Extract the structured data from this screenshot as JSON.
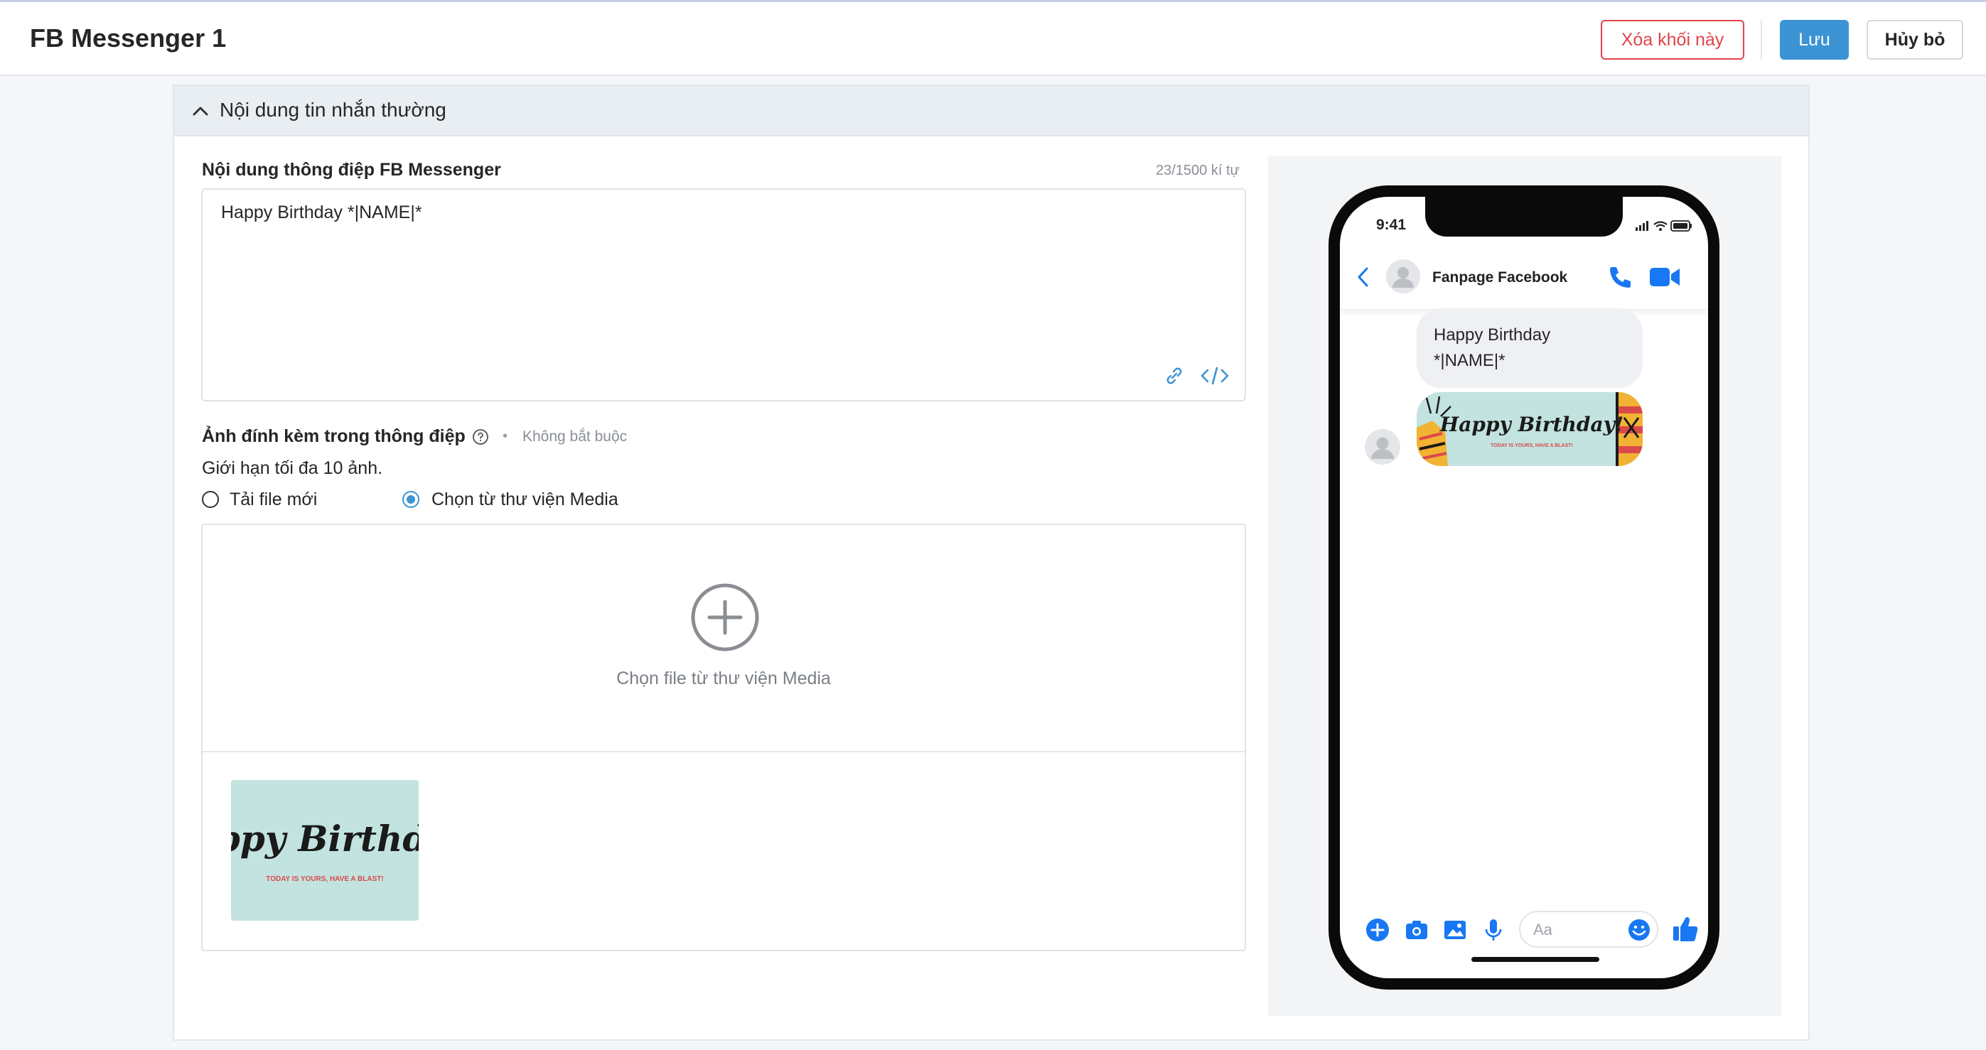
{
  "header": {
    "title": "FB Messenger 1",
    "delete_label": "Xóa khối này",
    "save_label": "Lưu",
    "cancel_label": "Hủy bỏ"
  },
  "section": {
    "title": "Nội dung tin nhắn thường"
  },
  "message": {
    "label": "Nội dung thông điệp FB Messenger",
    "counter": "23/1500 kí tự",
    "value": "Happy Birthday *|NAME|*"
  },
  "attachment": {
    "label": "Ảnh đính kèm trong thông điệp",
    "optional": "Không bắt buộc",
    "limit": "Giới hạn tối đa 10 ảnh.",
    "option_upload": "Tải file mới",
    "option_library": "Chọn từ thư viện Media",
    "selected_option": "library",
    "pick_label": "Chọn file từ thư viện Media",
    "thumb_text": "Happy Birthday",
    "thumb_subtext": "TODAY IS YOURS, HAVE A BLAST!"
  },
  "preview": {
    "time": "9:41",
    "contact_name": "Fanpage Facebook",
    "bubble_text": "Happy Birthday *|NAME|*",
    "image_text": "Happy Birthday!",
    "image_subtext": "TODAY IS YOURS, HAVE A BLAST!",
    "composer_placeholder": "Aa"
  },
  "colors": {
    "accent": "#3b93d4",
    "danger": "#e0454a",
    "messenger_blue": "#1877f2",
    "thumb_bg": "#c2e3df"
  }
}
